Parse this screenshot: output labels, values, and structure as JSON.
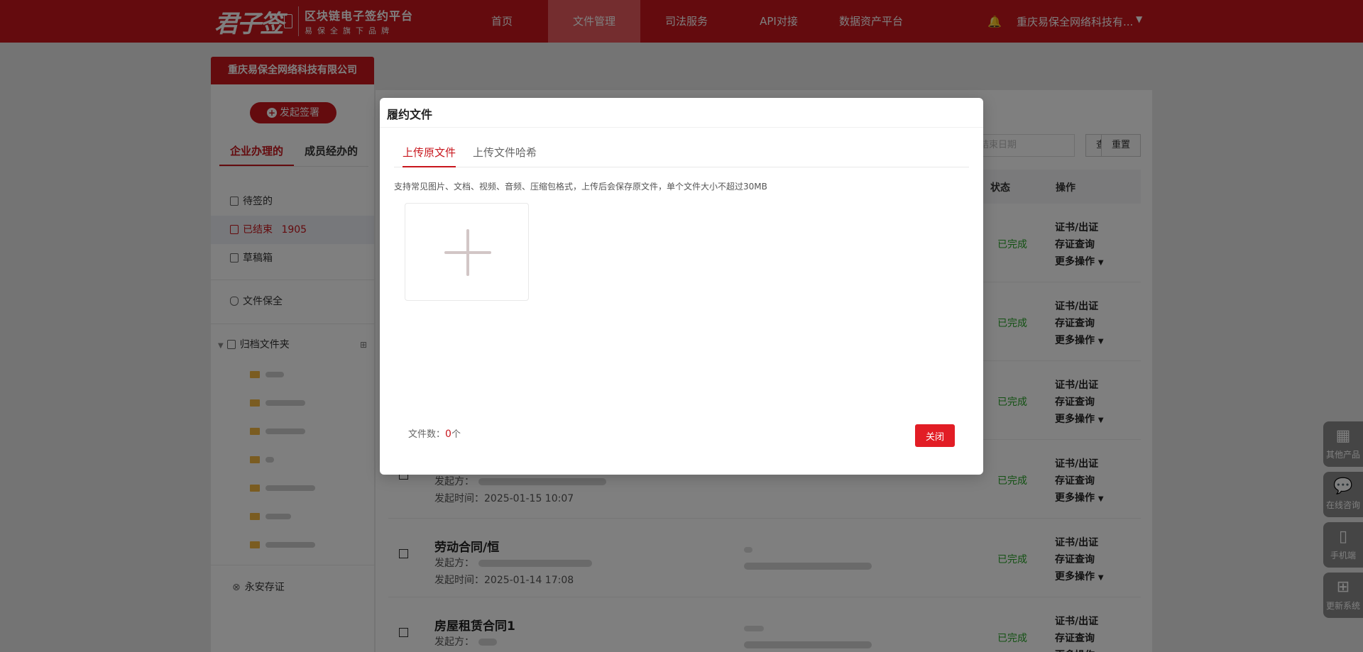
{
  "topbar": {
    "logo_mark": "君子签",
    "logo_title": "区块链电子签约平台",
    "logo_sub": "易保全旗下品牌",
    "nav": [
      "首页",
      "文件管理",
      "司法服务",
      "API对接",
      "数据资产平台"
    ],
    "active_nav": "文件管理",
    "user": "重庆易保全网络科技有..."
  },
  "company": "重庆易保全网络科技有限公司",
  "sidebar": {
    "start_button": "发起签署",
    "tabs": [
      "企业办理的",
      "成员经办的"
    ],
    "items": {
      "pending": "待签的",
      "finished": "已结束",
      "finished_count": "1905",
      "drafts": "草稿箱",
      "preserve": "文件保全",
      "archive": "归档文件夹",
      "evidence": "永安存证"
    }
  },
  "main": {
    "filter": {
      "end_date_placeholder": "结束日期",
      "query": "查询",
      "reset": "重置"
    },
    "columns": {
      "status": "状态",
      "actions": "操作"
    },
    "rows": [
      {
        "title": "",
        "initiator_label": "",
        "time_label": "",
        "time": "",
        "status": "已完成"
      },
      {
        "title": "",
        "initiator_label": "",
        "time_label": "",
        "time": "",
        "status": "已完成"
      },
      {
        "title": "",
        "initiator_label": "",
        "time_label": "",
        "time": "",
        "status": "已完成"
      },
      {
        "title": "",
        "initiator_label": "发起方：",
        "time_label": "发起时间：",
        "time": "2025-01-15 10:07",
        "status": "已完成"
      },
      {
        "title": "劳动合同/恒",
        "initiator_label": "发起方：",
        "time_label": "发起时间：",
        "time": "2025-01-14 17:08",
        "status": "已完成"
      },
      {
        "title": "房屋租赁合同1",
        "initiator_label": "发起方：",
        "time_label": "",
        "time": "",
        "status": "已完成"
      }
    ],
    "ops": [
      "证书/出证",
      "存证查询",
      "更多操作"
    ]
  },
  "float": [
    "其他产品",
    "在线咨询",
    "手机端",
    "更新系统"
  ],
  "modal": {
    "title": "履约文件",
    "tabs": [
      "上传原文件",
      "上传文件哈希"
    ],
    "hint": "支持常见图片、文档、视频、音频、压缩包格式，上传后会保存原文件，单个文件大小不超过30MB",
    "file_count_label": "文件数：",
    "file_count": "0",
    "file_count_unit": "个",
    "close": "关闭"
  }
}
